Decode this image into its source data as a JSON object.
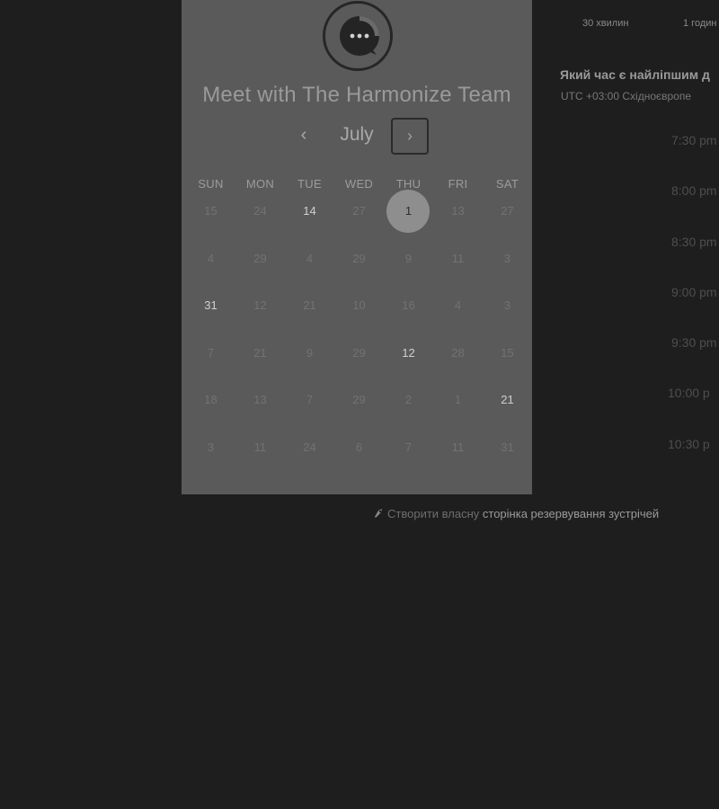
{
  "booking": {
    "title": "Meet with The Harmonize Team",
    "month": "July",
    "prev_label": "‹",
    "next_label": "›"
  },
  "calendar": {
    "weekdays": [
      "SUN",
      "MON",
      "TUE",
      "WED",
      "THU",
      "FRI",
      "SAT"
    ],
    "weeks": [
      [
        "15",
        "24",
        "14",
        "27",
        "1",
        "13",
        "27"
      ],
      [
        "4",
        "29",
        "4",
        "29",
        "9",
        "11",
        "3"
      ],
      [
        "31",
        "12",
        "21",
        "10",
        "16",
        "4",
        "3"
      ],
      [
        "7",
        "21",
        "9",
        "29",
        "12",
        "28",
        "15"
      ],
      [
        "18",
        "13",
        "7",
        "29",
        "2",
        "1",
        "21"
      ],
      [
        "3",
        "11",
        "24",
        "6",
        "7",
        "11",
        "31"
      ]
    ],
    "selected_day": "1"
  },
  "durations": [
    "30 хвилин",
    "1 годин"
  ],
  "schedule": {
    "question": "Який час є найліпшим д",
    "timezone": "UTC +03:00 Східноєвропе",
    "slots": [
      "7:30 pm",
      "8:00 pm",
      "8:30 pm",
      "9:00 pm",
      "9:30 pm",
      "10:00 p",
      "10:30 p"
    ]
  },
  "footer": {
    "prefix": "Створити власну",
    "link": "сторінка резервування зустрічей"
  }
}
